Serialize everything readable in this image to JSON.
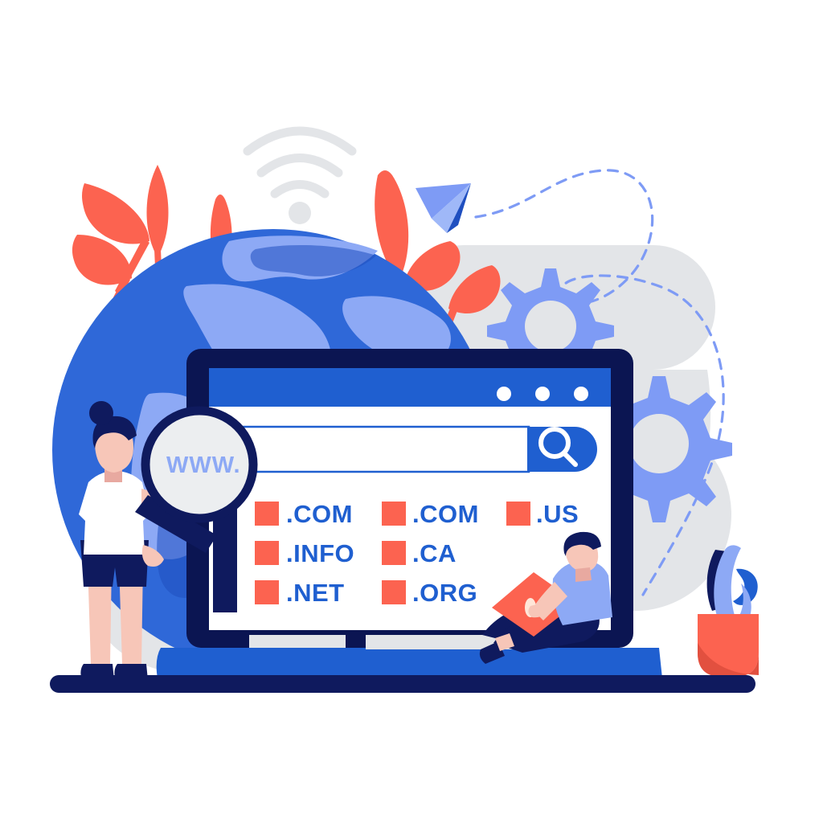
{
  "illustration": {
    "title": "Domain name registration search concept illustration",
    "background_color": "#ffffff"
  },
  "palette": {
    "coral": "#FC6350",
    "coral_dark": "#E2503F",
    "blue_primary": "#1f5fd0",
    "blue_mid": "#2f68d8",
    "blue_light": "#8da9f5",
    "blue_periwinkle": "#7e9bf5",
    "navy": "#0f1a5e",
    "navy_deep": "#0b1552",
    "gray_bg": "#e3e5e8",
    "gray_light": "#eceef0",
    "skin": "#f7c6b8",
    "skin_shadow": "#e8a9a0",
    "white": "#ffffff"
  },
  "browser": {
    "name": "browser-window",
    "titlebar": {
      "color": "#1f5fd0",
      "dots": [
        "dot-1",
        "dot-2",
        "dot-3"
      ]
    },
    "search": {
      "input_value": "",
      "placeholder": "",
      "button_icon": "search-icon",
      "button_color": "#1f5fd0"
    }
  },
  "magnifier": {
    "name": "magnifier",
    "lens_text": "WWW.",
    "ring_color": "#0f1a5e",
    "lens_color": "#eceef0"
  },
  "tld_list": {
    "columns": [
      {
        "name": "tld-column-1",
        "items": [
          {
            "label": ".COM",
            "swatch_color": "#FC6350"
          },
          {
            "label": ".INFO",
            "swatch_color": "#FC6350"
          },
          {
            "label": ".NET",
            "swatch_color": "#FC6350"
          }
        ]
      },
      {
        "name": "tld-column-2",
        "items": [
          {
            "label": ".COM",
            "swatch_color": "#FC6350"
          },
          {
            "label": ".CA",
            "swatch_color": "#FC6350"
          },
          {
            "label": ".ORG",
            "swatch_color": "#FC6350"
          }
        ]
      },
      {
        "name": "tld-column-3",
        "items": [
          {
            "label": ".US",
            "swatch_color": "#FC6350"
          }
        ]
      }
    ]
  },
  "characters": [
    {
      "name": "woman-with-magnifier",
      "hair_color": "#0f1a5e",
      "shirt_color": "#ffffff",
      "shorts_color": "#0f1a5e",
      "shoe_color": "#0f1a5e",
      "skin_color": "#f7c6b8"
    },
    {
      "name": "man-with-laptop",
      "hair_color": "#0f1a5e",
      "shirt_color": "#8da9f5",
      "pants_color": "#0f1a5e",
      "laptop_color": "#FC6350",
      "skin_color": "#f7c6b8"
    }
  ],
  "decor": {
    "globe": {
      "name": "globe",
      "ocean_color": "#2f68d8",
      "land_color": "#8da9f5"
    },
    "wifi": {
      "name": "wifi-icon",
      "color": "#e3e5e8",
      "arcs": 3
    },
    "paper_plane": {
      "name": "paper-plane-icon",
      "color": "#6f93f2",
      "accent": "#1f4fc0"
    },
    "dashed_trail": {
      "name": "dashed-trail",
      "color": "#7e9bf5"
    },
    "gears": [
      {
        "name": "gear-large-top",
        "color": "#7e9bf5",
        "teeth": 10
      },
      {
        "name": "gear-large-bottom",
        "color": "#7e9bf5",
        "teeth": 10
      }
    ],
    "leaves_left": {
      "name": "coral-leaves-left",
      "color": "#FC6350",
      "count": 4
    },
    "leaves_right": {
      "name": "coral-leaves-right",
      "color": "#FC6350",
      "count": 3
    },
    "plant_pot": {
      "name": "potted-plant",
      "pot_color": "#FC6350",
      "leaf_color": "#8da9f5"
    },
    "ground": {
      "name": "ground-bar",
      "color": "#0f1a5e"
    }
  }
}
